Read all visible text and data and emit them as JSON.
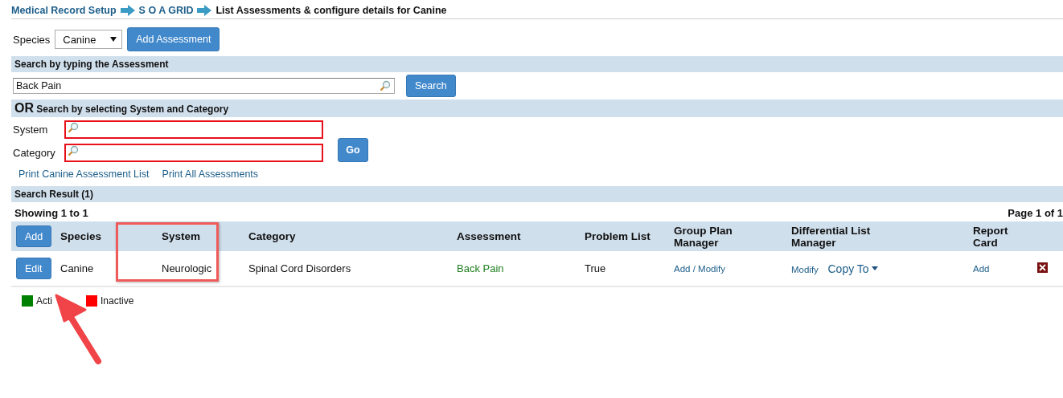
{
  "breadcrumb": [
    {
      "label": "Medical Record Setup",
      "kind": "link"
    },
    {
      "label": "S O A GRID",
      "kind": "link"
    },
    {
      "label": "List Assessments & configure details for Canine",
      "kind": "current"
    }
  ],
  "species": {
    "label": "Species",
    "value": "Canine",
    "button": "Add Assessment"
  },
  "text_search": {
    "heading": "Search by typing the Assessment",
    "value": "Back Pain",
    "button": "Search"
  },
  "filter_search": {
    "prefix": "OR",
    "heading": "Search by selecting System and Category",
    "fields": [
      {
        "label": "System"
      },
      {
        "label": "Category"
      }
    ],
    "button": "Go"
  },
  "links": [
    "Print Canine Assessment List",
    "Print All Assessments"
  ],
  "results": {
    "heading": "Search Result (1)",
    "showing": "Showing 1 to 1",
    "page": "Page 1 of 1",
    "add_button": "Add",
    "columns": [
      "Species",
      "System",
      "Category",
      "Assessment",
      "Problem List",
      "Group Plan Manager",
      "Differential List Manager",
      "Report Card"
    ],
    "rows": [
      {
        "edit": "Edit",
        "species": "Canine",
        "system": "Neurologic",
        "category": "Spinal Cord Disorders",
        "assessment": "Back Pain",
        "active": true,
        "problem_list": "True",
        "group_plan": "Add / Modify",
        "differential": "Modify",
        "copy_to": "Copy To",
        "report_card": "Add"
      }
    ]
  },
  "legend": [
    {
      "label": "Acti",
      "color": "#008000"
    },
    {
      "label": "Inactive",
      "color": "#ff0000"
    }
  ]
}
